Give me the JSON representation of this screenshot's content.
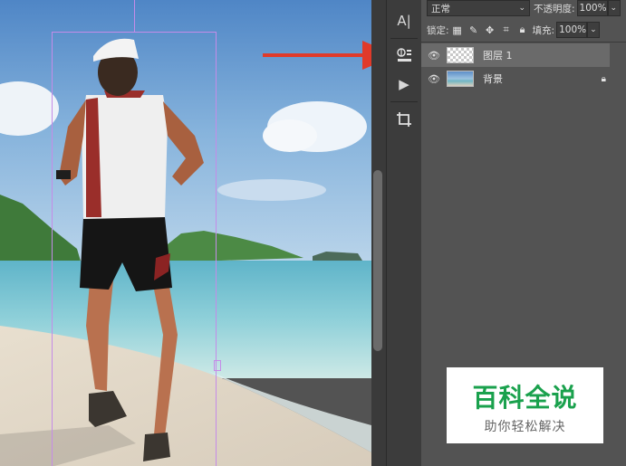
{
  "layers_panel": {
    "blend_mode": "正常",
    "opacity_label": "不透明度:",
    "opacity_value": "100%",
    "lock_label": "锁定:",
    "fill_label": "填充:",
    "fill_value": "100%",
    "layers": [
      {
        "name": "图层 1",
        "selected": true
      },
      {
        "name": "背景",
        "selected": false
      }
    ]
  },
  "toolstrip": {
    "type_tool": "A|",
    "play_tool": "▶"
  },
  "watermark": {
    "title": "百科全说",
    "subtitle": "助你轻松解决"
  },
  "colors": {
    "guide": "#c58be8",
    "arrow": "#e03a2a",
    "watermark_green": "#1aa14d",
    "panel_bg": "#535353"
  }
}
